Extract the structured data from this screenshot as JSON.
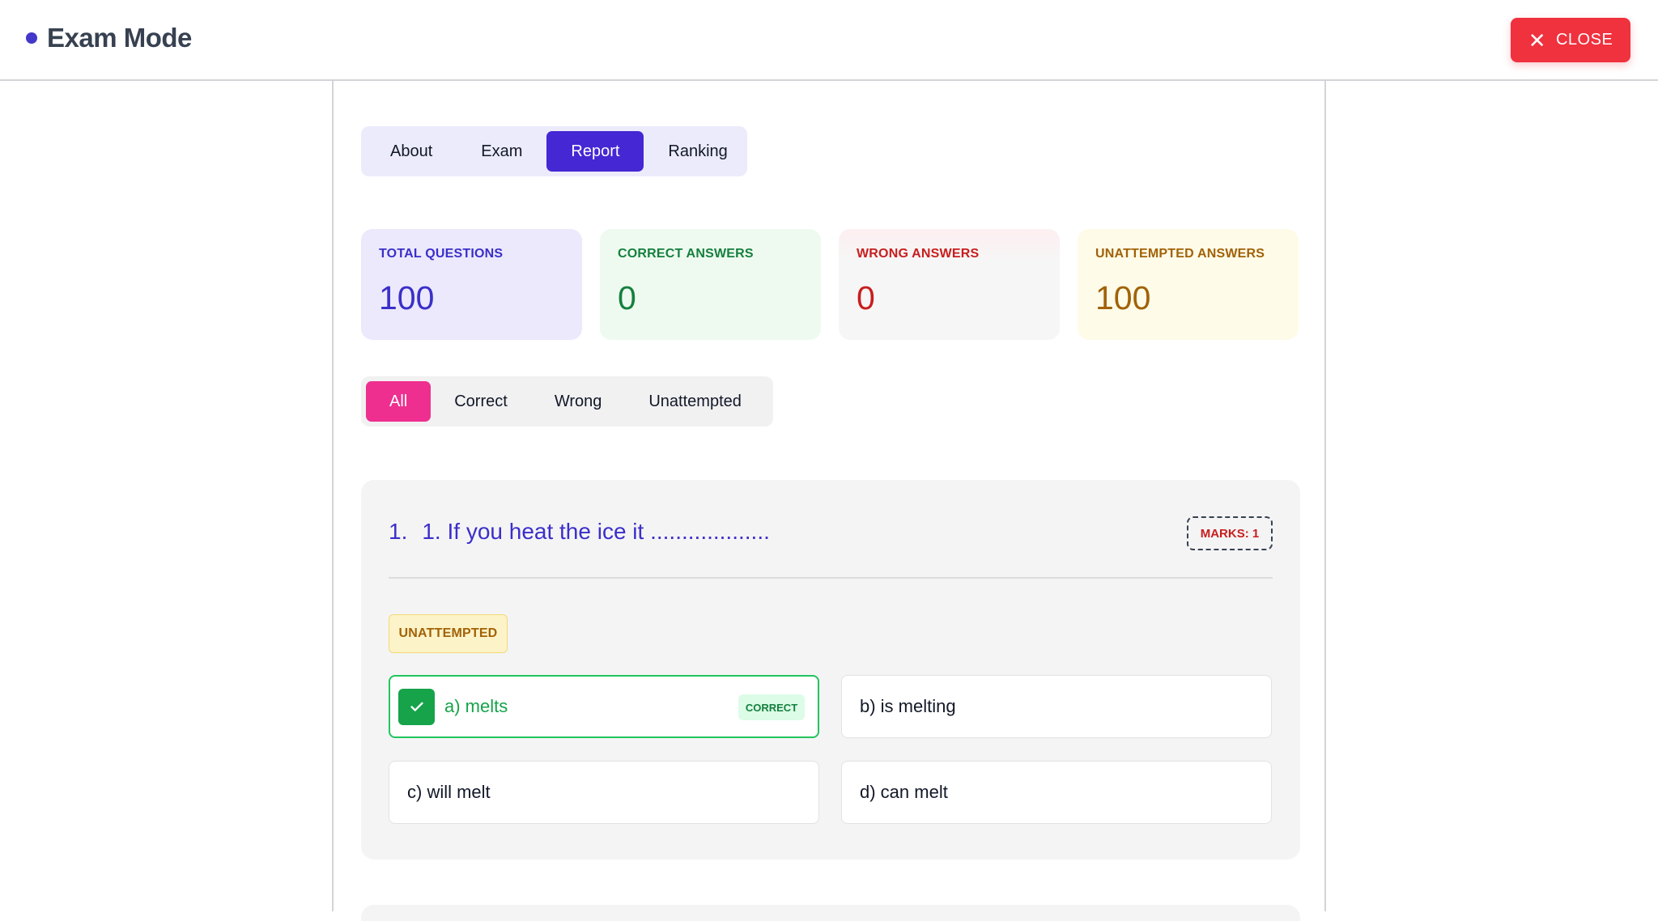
{
  "header": {
    "title": "Exam Mode",
    "close_label": "CLOSE"
  },
  "tabs": [
    {
      "label": "About"
    },
    {
      "label": "Exam"
    },
    {
      "label": "Report"
    },
    {
      "label": "Ranking"
    }
  ],
  "stats": {
    "total": {
      "label": "TOTAL QUESTIONS",
      "value": "100"
    },
    "correct": {
      "label": "CORRECT ANSWERS",
      "value": "0"
    },
    "wrong": {
      "label": "WRONG ANSWERS",
      "value": "0"
    },
    "unattempted": {
      "label": "UNATTEMPTED ANSWERS",
      "value": "100"
    }
  },
  "filters": [
    {
      "label": "All"
    },
    {
      "label": "Correct"
    },
    {
      "label": "Wrong"
    },
    {
      "label": "Unattempted"
    }
  ],
  "question": {
    "number": "1.",
    "text": "1. If you heat the ice it ...................",
    "marks": "MARKS: 1",
    "status": "UNATTEMPTED",
    "correct_tag": "CORRECT",
    "options": [
      {
        "label": "a) melts"
      },
      {
        "label": "b) is melting"
      },
      {
        "label": "c) will melt"
      },
      {
        "label": "d) can melt"
      }
    ]
  },
  "colors": {
    "accent": "#4527d4",
    "close": "#f0313e",
    "filter_active": "#ee2f8f",
    "correct": "#16a34a",
    "wrong": "#c81e1e",
    "unattempted": "#a16207"
  }
}
